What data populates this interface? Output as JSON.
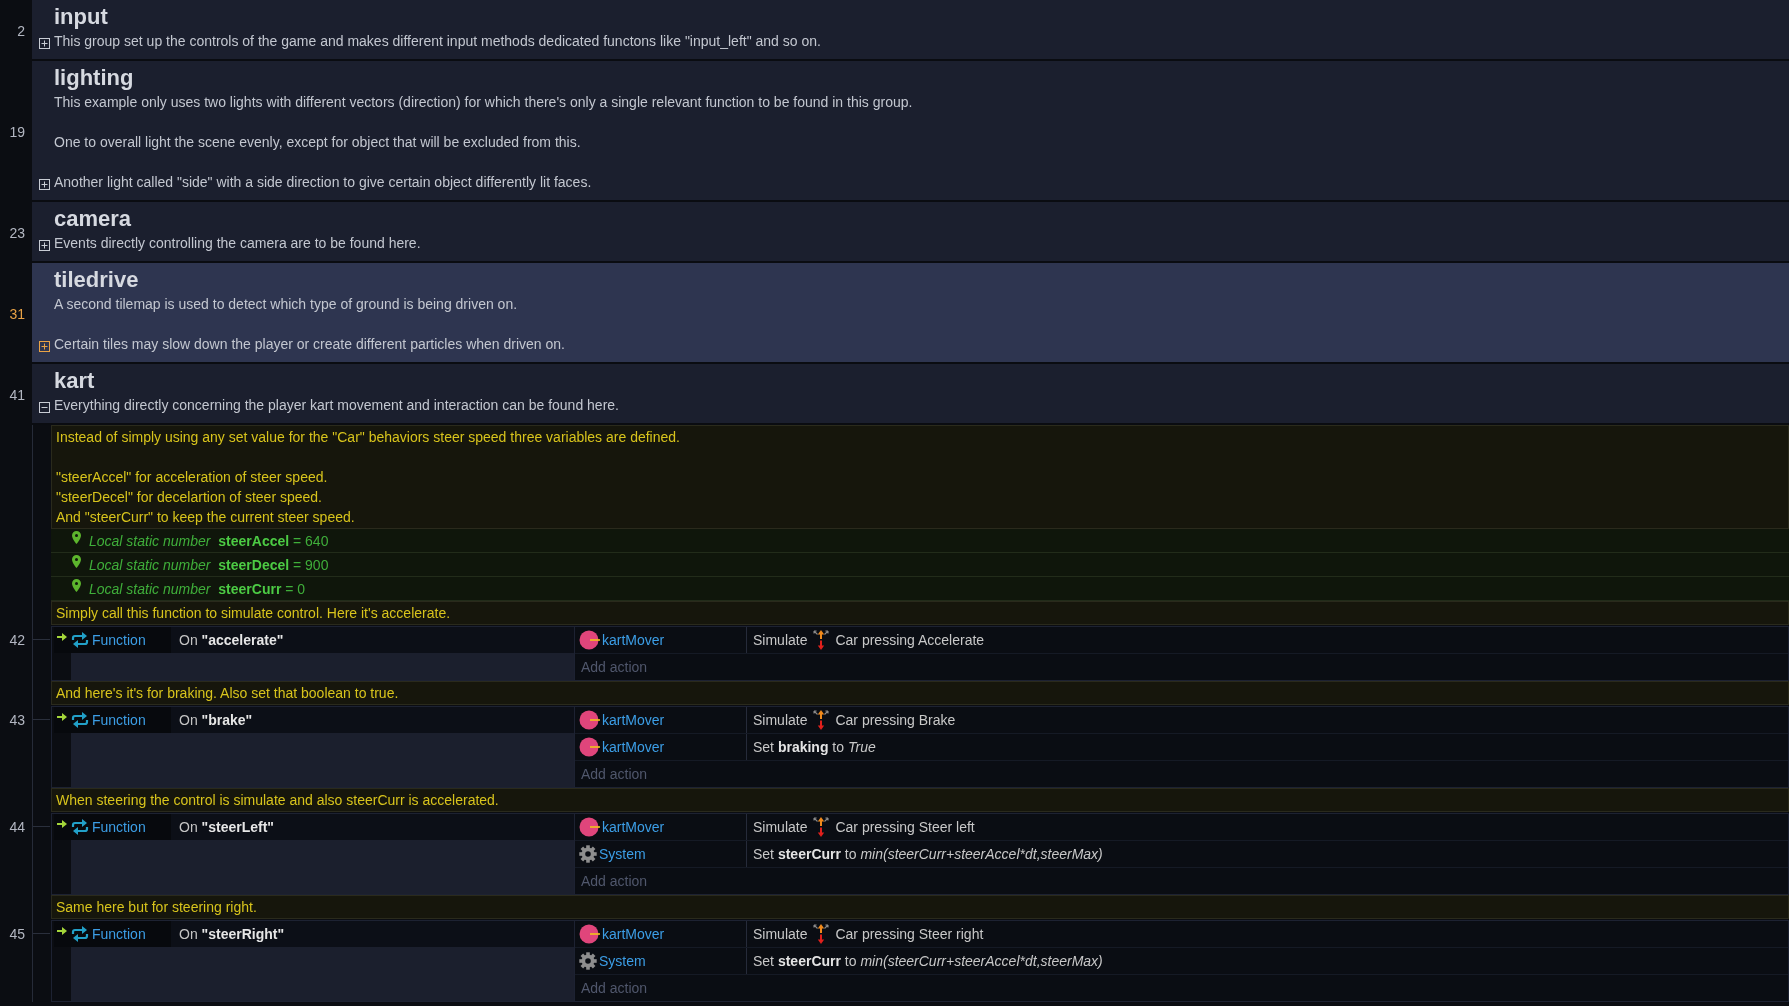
{
  "groups": [
    {
      "line": "2",
      "title": "input",
      "description": "This group set up the controls of the game and makes different input methods dedicated functons like \"input_left\" and so on.",
      "expanded": false,
      "selected": false
    },
    {
      "line": "19",
      "title": "lighting",
      "description": "This example only uses two lights with different vectors (direction) for which there's only a single relevant function to be found in this group.\n\nOne to overall light the scene evenly, except for object that will be excluded from this.\n\nAnother light called \"side\" with a side direction to give certain object differently lit faces.",
      "expanded": false,
      "selected": false
    },
    {
      "line": "23",
      "title": "camera",
      "description": "Events directly controlling the camera are to be found here.",
      "expanded": false,
      "selected": false
    },
    {
      "line": "31",
      "title": "tiledrive",
      "description": "A second tilemap is used to detect which type of ground is being driven on.\n\nCertain tiles may slow down the player or create different particles when driven on.",
      "expanded": false,
      "selected": true
    },
    {
      "line": "41",
      "title": "kart",
      "description": "Everything directly concerning the player kart movement and interaction can be found here.",
      "expanded": true,
      "selected": false,
      "children": [
        {
          "kind": "comment",
          "text": "Instead of simply using any set value for the \"Car\" behaviors steer speed three variables are defined.\n\n\"steerAccel\" for acceleration of steer speed.\n\"steerDecel\" for decelartion of steer speed.\nAnd \"steerCurr\" to keep the current steer speed."
        },
        {
          "kind": "variable",
          "text": "*Local static number* **steerAccel** = 640"
        },
        {
          "kind": "variable",
          "text": "*Local static number* **steerDecel** = 900"
        },
        {
          "kind": "variable",
          "text": "*Local static number* **steerCurr** = 0"
        },
        {
          "kind": "comment",
          "text": "Simply call this function to simulate control. Here it's accelerate."
        },
        {
          "kind": "event",
          "line": "42",
          "object": "Function",
          "condition": "On **\"accelerate\"**",
          "actions": [
            {
              "object": {
                "kind": "sprite",
                "name": "kartMover"
              },
              "kind": "simulate",
              "verb": "Simulate",
              "control": "Car pressing Accelerate"
            }
          ],
          "add_action": "Add action"
        },
        {
          "kind": "comment",
          "text": "And here's it's for braking. Also set that boolean to true."
        },
        {
          "kind": "event",
          "line": "43",
          "object": "Function",
          "condition": "On **\"brake\"**",
          "actions": [
            {
              "object": {
                "kind": "sprite",
                "name": "kartMover"
              },
              "kind": "simulate",
              "verb": "Simulate",
              "control": "Car pressing Brake"
            },
            {
              "object": {
                "kind": "sprite",
                "name": "kartMover"
              },
              "kind": "set",
              "verb": "Set",
              "variable": "braking",
              "preposition": "to",
              "value": "True"
            }
          ],
          "add_action": "Add action"
        },
        {
          "kind": "comment",
          "text": "When steering the control is simulate and also steerCurr is accelerated."
        },
        {
          "kind": "event",
          "line": "44",
          "object": "Function",
          "condition": "On **\"steerLeft\"**",
          "actions": [
            {
              "object": {
                "kind": "sprite",
                "name": "kartMover"
              },
              "kind": "simulate",
              "verb": "Simulate",
              "control": "Car pressing Steer left"
            },
            {
              "object": {
                "kind": "system",
                "name": "System"
              },
              "kind": "set",
              "verb": "Set",
              "variable": "steerCurr",
              "preposition": "to",
              "value": "min(steerCurr+steerAccel*dt,steerMax)"
            }
          ],
          "add_action": "Add action"
        },
        {
          "kind": "comment",
          "text": "Same here but for steering right."
        },
        {
          "kind": "event",
          "line": "45",
          "object": "Function",
          "condition": "On **\"steerRight\"**",
          "actions": [
            {
              "object": {
                "kind": "sprite",
                "name": "kartMover"
              },
              "kind": "simulate",
              "verb": "Simulate",
              "control": "Car pressing Steer right"
            },
            {
              "object": {
                "kind": "system",
                "name": "System"
              },
              "kind": "set",
              "verb": "Set",
              "variable": "steerCurr",
              "preposition": "to",
              "value": "min(steerCurr+steerAccel*dt,steerMax)"
            }
          ],
          "add_action": "Add action"
        }
      ]
    }
  ]
}
